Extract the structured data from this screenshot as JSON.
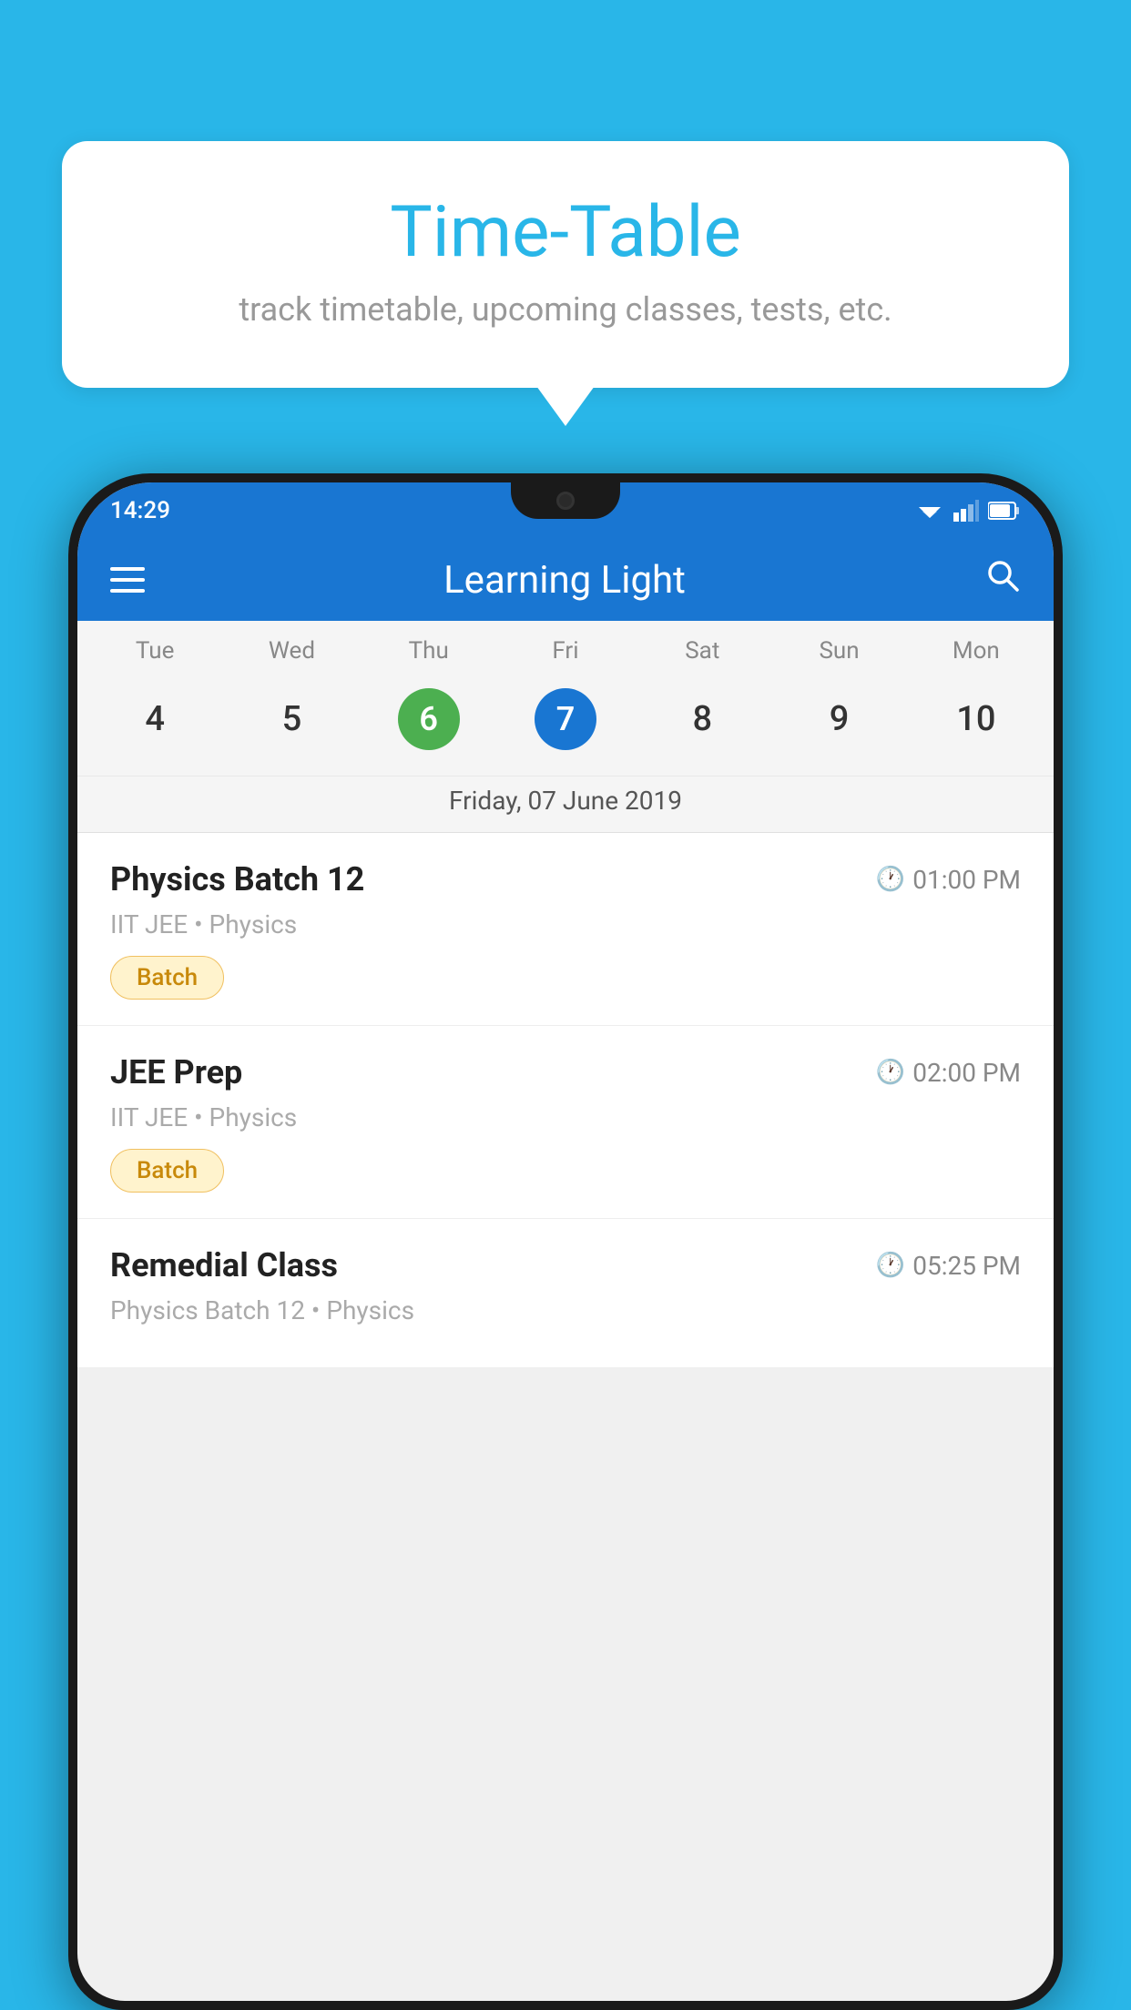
{
  "background_color": "#29B6E8",
  "tooltip": {
    "title": "Time-Table",
    "subtitle": "track timetable, upcoming classes, tests, etc."
  },
  "phone": {
    "status_bar": {
      "time": "14:29"
    },
    "app_bar": {
      "title": "Learning Light"
    },
    "calendar": {
      "days_of_week": [
        "Tue",
        "Wed",
        "Thu",
        "Fri",
        "Sat",
        "Sun",
        "Mon"
      ],
      "dates": [
        "4",
        "5",
        "6",
        "7",
        "8",
        "9",
        "10"
      ],
      "today_index": 2,
      "selected_index": 3,
      "selected_date_label": "Friday, 07 June 2019"
    },
    "schedule_items": [
      {
        "title": "Physics Batch 12",
        "time": "01:00 PM",
        "subtitle": "IIT JEE • Physics",
        "badge": "Batch"
      },
      {
        "title": "JEE Prep",
        "time": "02:00 PM",
        "subtitle": "IIT JEE • Physics",
        "badge": "Batch"
      },
      {
        "title": "Remedial Class",
        "time": "05:25 PM",
        "subtitle": "Physics Batch 12 • Physics",
        "badge": null
      }
    ]
  }
}
